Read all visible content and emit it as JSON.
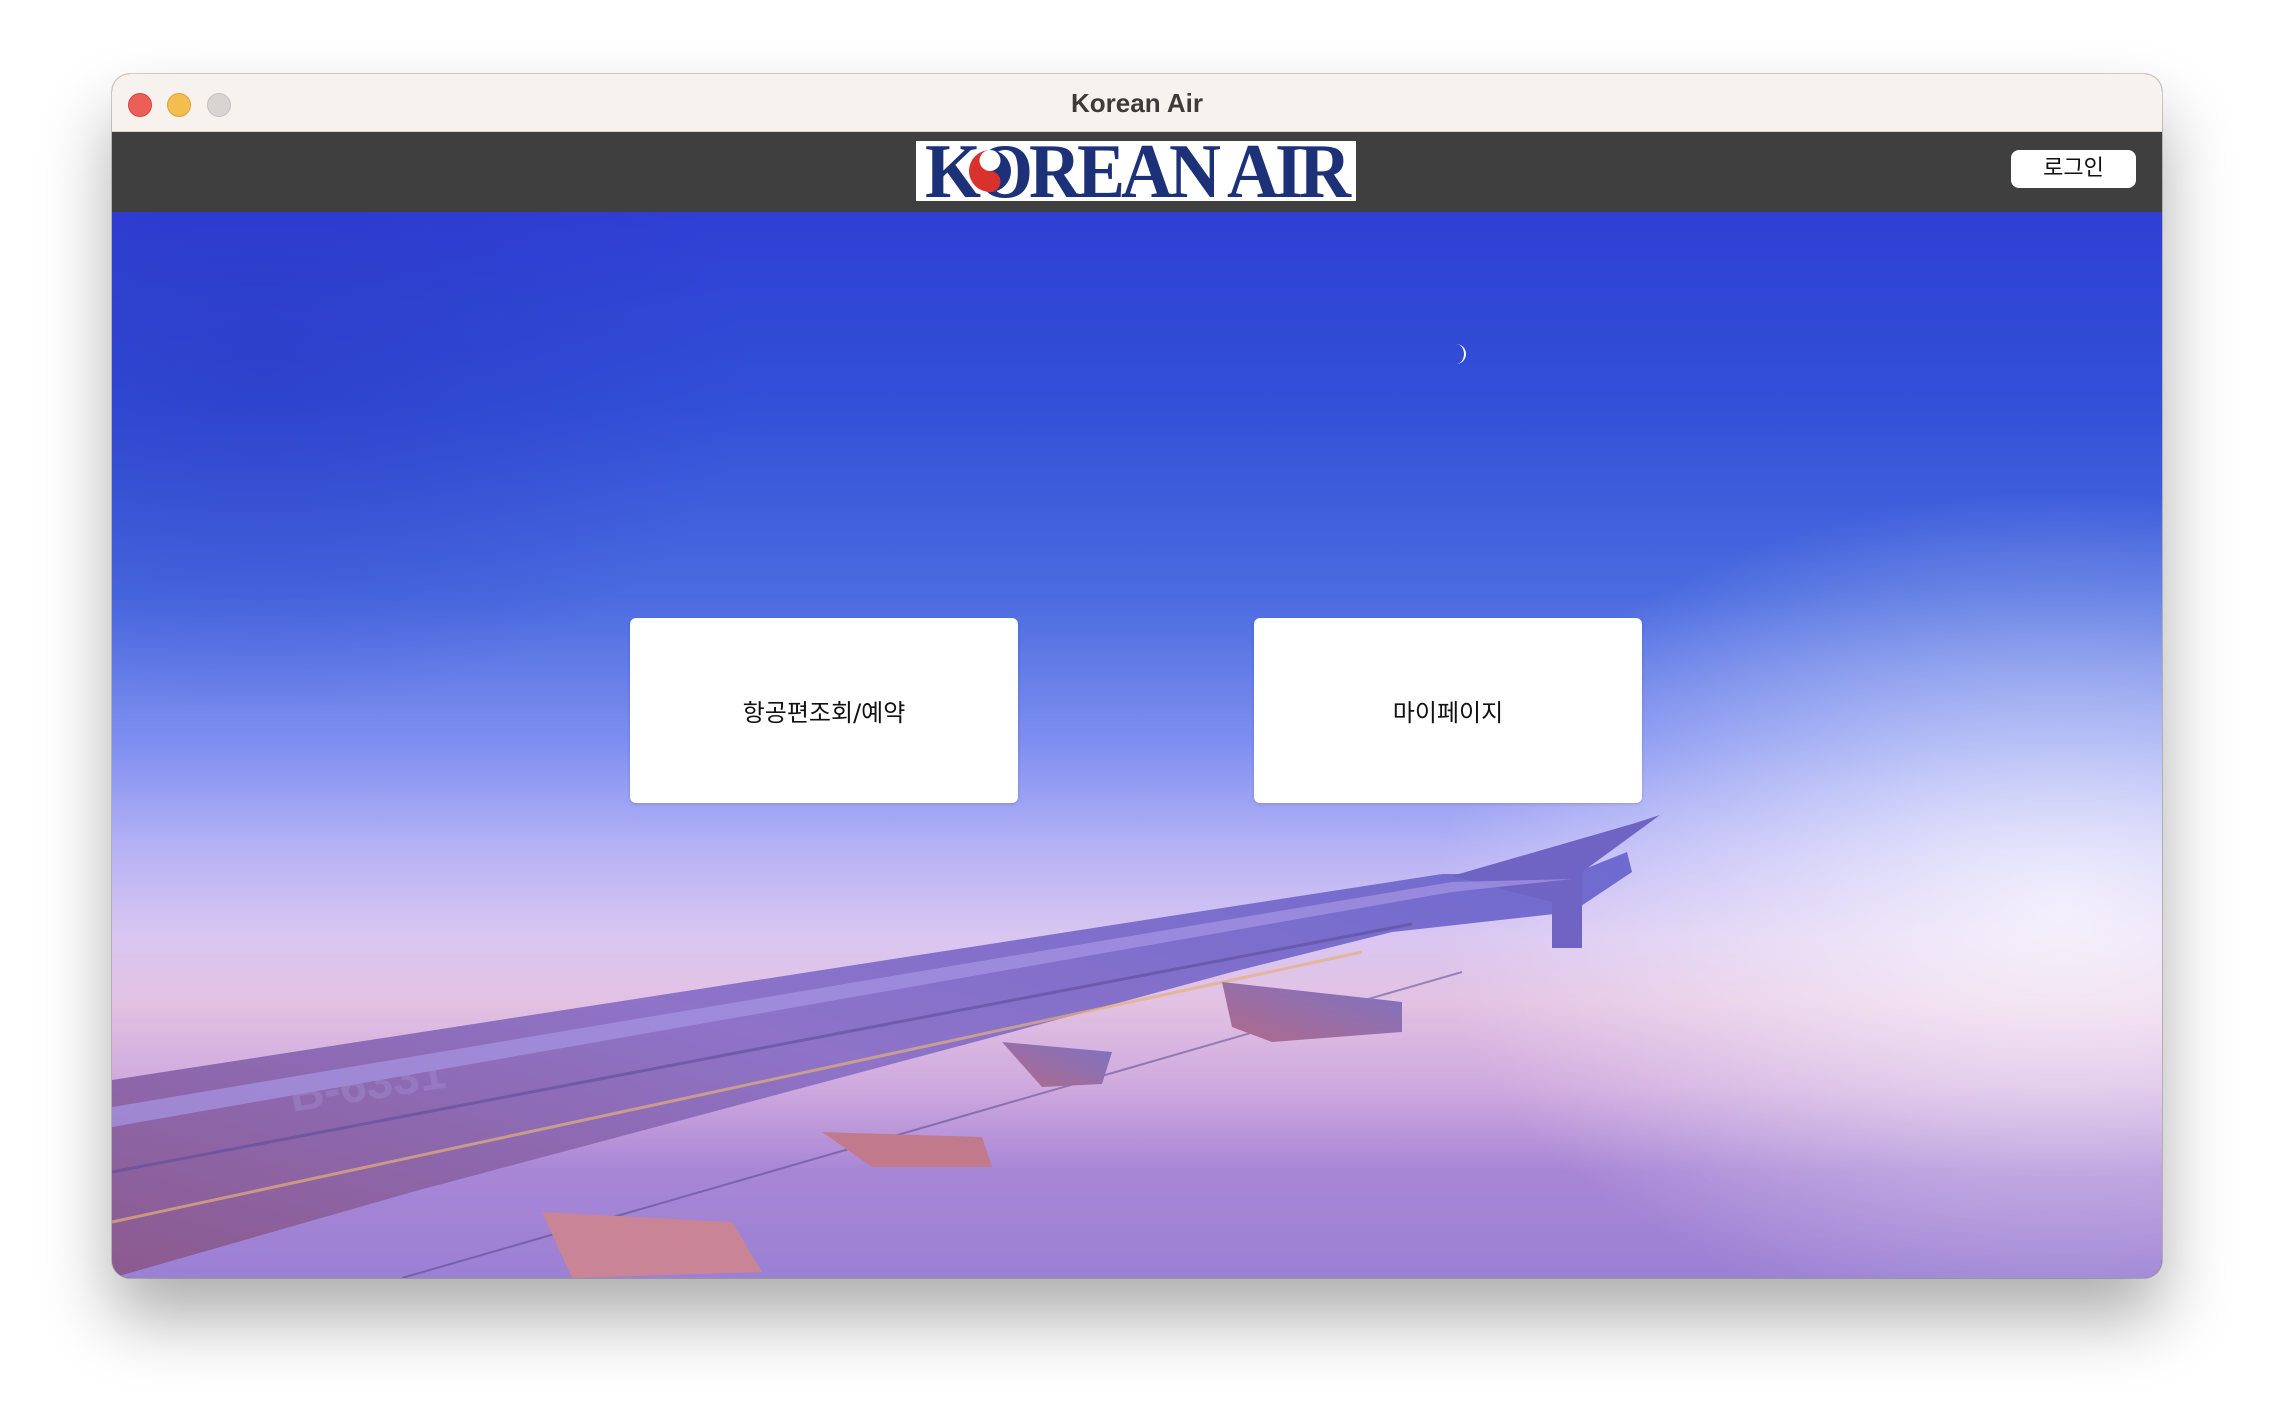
{
  "window": {
    "title": "Korean Air"
  },
  "header": {
    "logo_text": "KOREAN AIR",
    "login_label": "로그인"
  },
  "menu": {
    "items": [
      {
        "label": "항공편조회/예약"
      },
      {
        "label": "마이페이지"
      }
    ]
  },
  "colors": {
    "navbar": "#3f3f3f",
    "logo_blue": "#1d3178",
    "logo_red": "#d9312b",
    "titlebar": "#f7f2ee"
  },
  "icons": {
    "close": "close-traffic-light",
    "minimize": "minimize-traffic-light",
    "zoom": "zoom-traffic-light",
    "emblem": "taegeuk-emblem-icon"
  }
}
